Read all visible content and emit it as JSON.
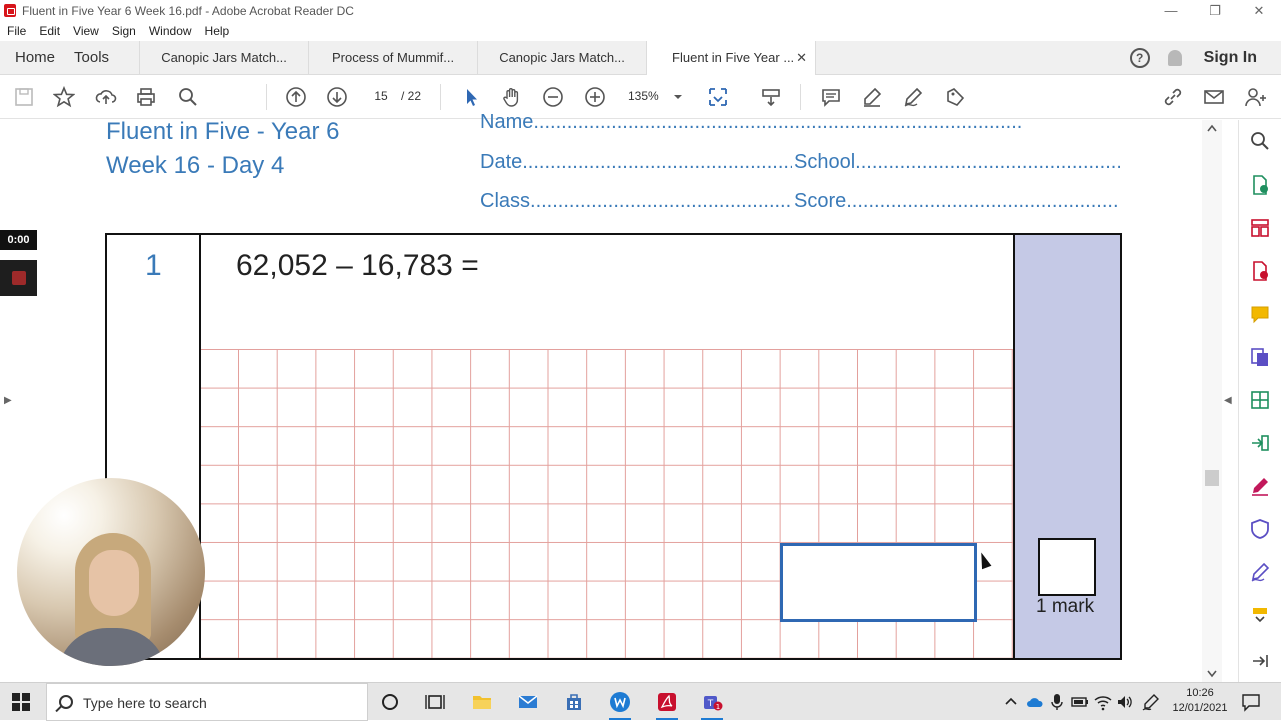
{
  "window": {
    "title": "Fluent in Five Year 6 Week 16.pdf - Adobe Acrobat Reader DC",
    "minimize": "—",
    "restore": "❐",
    "close": "✕"
  },
  "menu": [
    "File",
    "Edit",
    "View",
    "Sign",
    "Window",
    "Help"
  ],
  "tabs": {
    "home": "Home",
    "tools": "Tools",
    "documents": [
      {
        "label": "Canopic Jars Match..."
      },
      {
        "label": "Process of Mummif..."
      },
      {
        "label": "Canopic Jars Match..."
      },
      {
        "label": "Fluent in Five Year ...",
        "active": true
      }
    ],
    "close_glyph": "✕",
    "help_glyph": "?",
    "sign_in": "Sign In"
  },
  "toolbar": {
    "page_current": "15",
    "page_total": "/ 22",
    "zoom": "135%"
  },
  "document": {
    "title_line1": "Fluent in Five - Year 6",
    "title_line2": "Week 16 - Day 4",
    "name_field": "Name........................................................................................",
    "date_field": "Date...................................................",
    "school_field": "School.........................................................",
    "class_field": "Class..................................................",
    "score_field": "Score.........................................................",
    "question_number": "1",
    "question": "62,052 – 16,783 =",
    "mark_label": "1 mark"
  },
  "recording": {
    "timer": "0:00"
  },
  "taskbar": {
    "search_placeholder": "Type here to search",
    "time": "10:26",
    "date": "12/01/2021"
  },
  "colors": {
    "accent_blue": "#3a7ab8",
    "mark_column": "#c5c9e6",
    "grid_line": "#e3a09c",
    "answer_box": "#2f68b3"
  }
}
